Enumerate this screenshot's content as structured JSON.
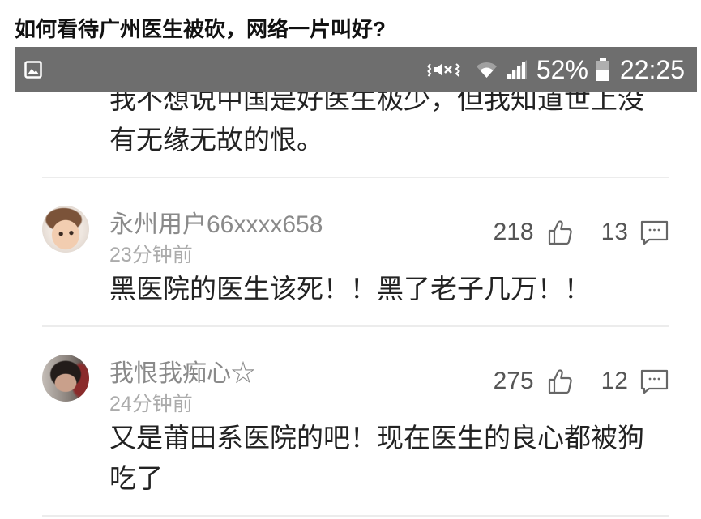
{
  "article": {
    "title": "如何看待广州医生被砍，网络一片叫好?"
  },
  "status_bar": {
    "notification_icon": "image-icon",
    "indicator_icons": [
      "vibrate-mute-icon",
      "wifi-icon",
      "signal-icon"
    ],
    "battery_percent": "52%",
    "battery_icon": "battery-icon",
    "time": "22:25"
  },
  "comments": {
    "previous_comment_text": "我不想说中国是好医生极少，但我知道世上没有无缘无故的恨。",
    "like_icon": "thumbs-up-icon",
    "reply_icon": "comment-icon",
    "items": [
      {
        "username": "永州用户66xxxx658",
        "time_ago": "23分钟前",
        "likes": "218",
        "replies": "13",
        "text": "黑医院的医生该死！！黑了老子几万！！"
      },
      {
        "username": "我恨我痴心☆",
        "time_ago": "24分钟前",
        "likes": "275",
        "replies": "12",
        "text": "又是莆田系医院的吧！现在医生的良心都被狗吃了"
      }
    ]
  },
  "colors": {
    "status_bar_background": "#6e6e6e",
    "status_bar_foreground": "#ffffff",
    "comment_text": "#222222",
    "username": "#8a8a8a",
    "meta": "#ababab",
    "counts": "#555555",
    "icon": "#666666",
    "divider": "#ececec"
  }
}
